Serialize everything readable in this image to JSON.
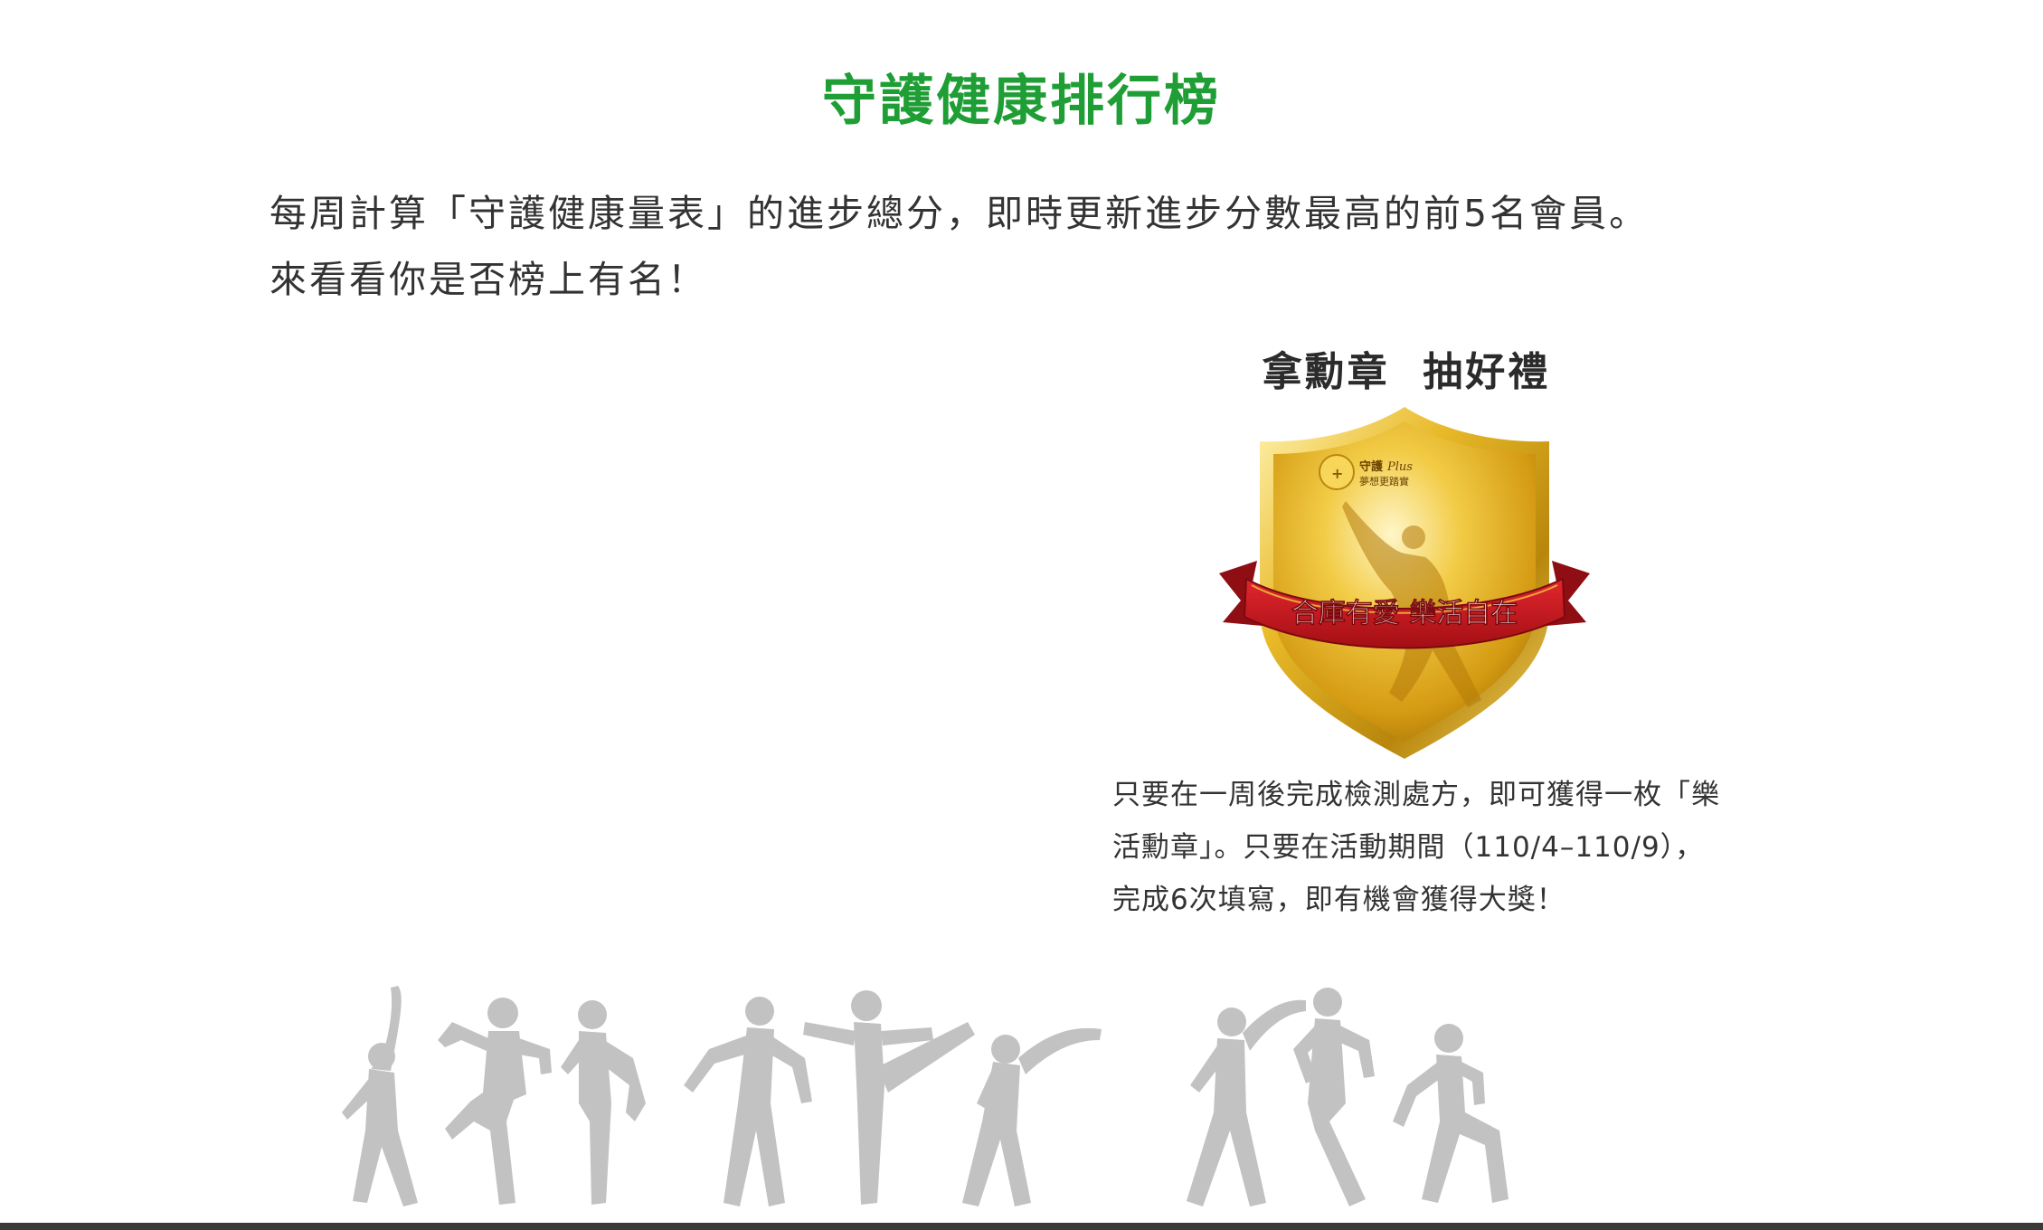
{
  "page_title": "守護健康排行榜",
  "intro": {
    "line1": "每周計算「守護健康量表」的進步總分，即時更新進步分數最高的前5名會員。",
    "line2": "來看看你是否榜上有名！"
  },
  "medal": {
    "title": "拿勳章  抽好禮",
    "badge_ribbon_text": "合庫有愛 樂活自在",
    "badge_logo_text_1": "守護",
    "badge_logo_text_2": "夢想更踏實",
    "badge_logo_script": "Plus",
    "desc_line1": "只要在一周後完成檢測處方，即可獲得一枚「樂",
    "desc_line2": "活勳章」。只要在活動期間（110/4–110/9），",
    "desc_line3": "完成6次填寫，即有機會獲得大獎！"
  },
  "colors": {
    "title_green": "#1f9e35",
    "gold": "#e2b227",
    "ribbon_red": "#c8161d",
    "silhouette_gray": "#c2c2c2"
  },
  "icons": {
    "badge": "medal-shield-icon",
    "dancers": "dancer-silhouettes-icon"
  }
}
